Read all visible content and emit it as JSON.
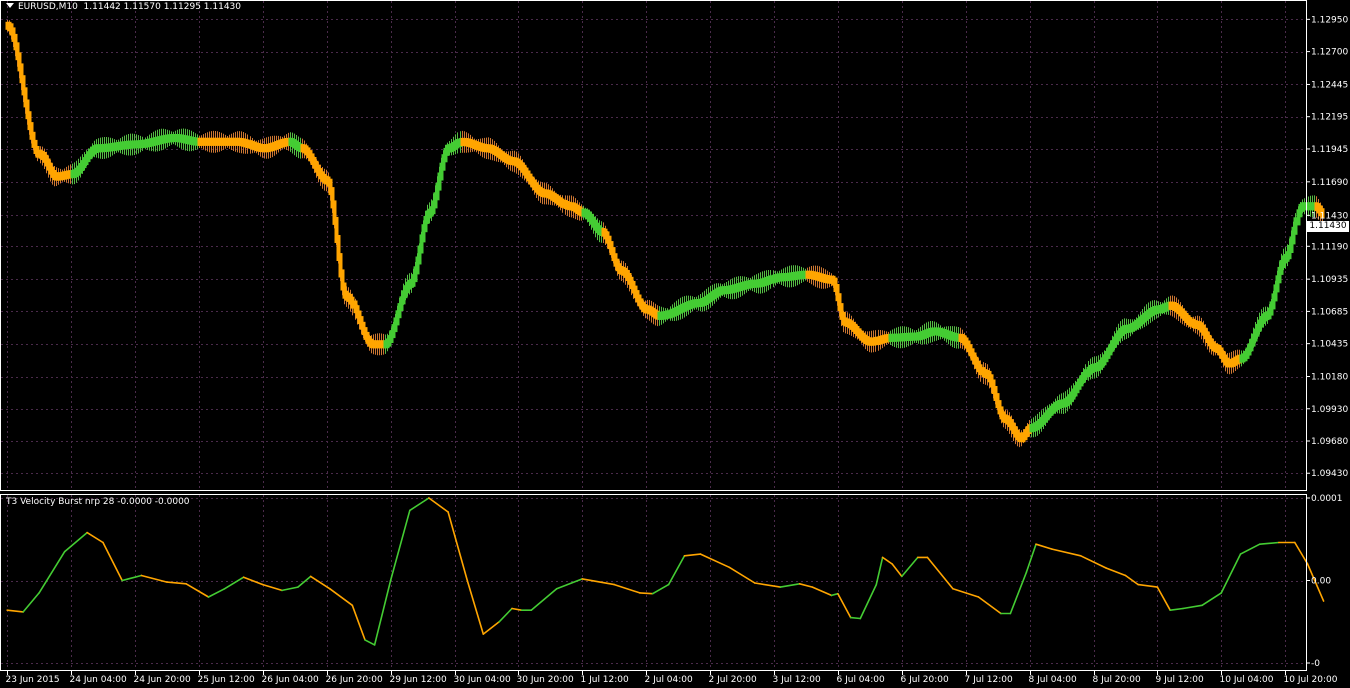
{
  "window": {
    "main_header": "EURUSD,M10  1.11442 1.11570 1.11295 1.11430",
    "indicator_header": "T3 Velocity Burst nrp 28 -0.0000 -0.0000",
    "current_price": "1.11430"
  },
  "colors": {
    "background": "#000000",
    "grid": "#4a2a4a",
    "frame": "#ffffff",
    "up": "#44cc33",
    "down": "#ffa500",
    "up_wick": "#55bb44",
    "down_wick": "#cc7733"
  },
  "chart_data": [
    {
      "type": "line",
      "name": "main-price",
      "ylim": [
        1.093,
        1.131
      ],
      "price_ticks": [
        "1.12950",
        "1.12700",
        "1.12445",
        "1.12195",
        "1.11945",
        "1.11690",
        "1.11430",
        "1.11190",
        "1.10935",
        "1.10685",
        "1.10435",
        "1.10180",
        "1.09930",
        "1.09680",
        "1.09430"
      ],
      "price_tick_values": [
        1.1295,
        1.127,
        1.12445,
        1.12195,
        1.11945,
        1.1169,
        1.1143,
        1.1119,
        1.10935,
        1.10685,
        1.10435,
        1.1018,
        1.0993,
        1.0968,
        1.0943
      ],
      "x_labels": [
        "23 Jun 2015",
        "24 Jun 04:00",
        "24 Jun 20:00",
        "25 Jun 12:00",
        "26 Jun 04:00",
        "26 Jun 20:00",
        "29 Jun 12:00",
        "30 Jun 04:00",
        "30 Jun 20:00",
        "1 Jul 12:00",
        "2 Jul 04:00",
        "2 Jul 20:00",
        "3 Jul 12:00",
        "6 Jul 04:00",
        "6 Jul 20:00",
        "7 Jul 12:00",
        "8 Jul 04:00",
        "8 Jul 20:00",
        "9 Jul 12:00",
        "10 Jul 04:00",
        "10 Jul 20:00"
      ],
      "x_label_positions": [
        0,
        1,
        2,
        3,
        4,
        5,
        6,
        7,
        8,
        9,
        10,
        11,
        12,
        13,
        14,
        15,
        16,
        17,
        18,
        19,
        20
      ],
      "xlim": [
        -0.05,
        20.2
      ],
      "keypoints": [
        [
          0.0,
          1.129,
          "down"
        ],
        [
          0.5,
          1.119,
          "down"
        ],
        [
          0.75,
          1.1173,
          "down"
        ],
        [
          1.0,
          1.1175,
          "up"
        ],
        [
          1.4,
          1.1195,
          "up"
        ],
        [
          2.0,
          1.1198,
          "up"
        ],
        [
          2.6,
          1.1203,
          "up"
        ],
        [
          3.0,
          1.12,
          "down"
        ],
        [
          3.6,
          1.12,
          "down"
        ],
        [
          4.0,
          1.1195,
          "down"
        ],
        [
          4.4,
          1.12,
          "up"
        ],
        [
          4.6,
          1.1195,
          "down"
        ],
        [
          5.0,
          1.117,
          "down"
        ],
        [
          5.3,
          1.108,
          "down"
        ],
        [
          5.7,
          1.1043,
          "down"
        ],
        [
          5.9,
          1.1043,
          "up"
        ],
        [
          6.3,
          1.109,
          "up"
        ],
        [
          6.6,
          1.1145,
          "up"
        ],
        [
          6.9,
          1.1195,
          "up"
        ],
        [
          7.1,
          1.12,
          "down"
        ],
        [
          7.5,
          1.1195,
          "down"
        ],
        [
          7.9,
          1.1185,
          "down"
        ],
        [
          8.4,
          1.116,
          "down"
        ],
        [
          8.8,
          1.115,
          "down"
        ],
        [
          9.0,
          1.1145,
          "up"
        ],
        [
          9.3,
          1.113,
          "down"
        ],
        [
          9.6,
          1.11,
          "down"
        ],
        [
          10.0,
          1.107,
          "down"
        ],
        [
          10.2,
          1.1065,
          "up"
        ],
        [
          10.8,
          1.1075,
          "up"
        ],
        [
          11.2,
          1.1085,
          "up"
        ],
        [
          11.7,
          1.109,
          "up"
        ],
        [
          12.1,
          1.1095,
          "up"
        ],
        [
          12.5,
          1.1097,
          "down"
        ],
        [
          12.9,
          1.1093,
          "down"
        ],
        [
          13.1,
          1.106,
          "down"
        ],
        [
          13.5,
          1.1045,
          "down"
        ],
        [
          13.8,
          1.1048,
          "up"
        ],
        [
          14.2,
          1.1049,
          "up"
        ],
        [
          14.5,
          1.1053,
          "up"
        ],
        [
          14.9,
          1.1048,
          "down"
        ],
        [
          15.3,
          1.102,
          "down"
        ],
        [
          15.6,
          1.0985,
          "down"
        ],
        [
          15.85,
          1.097,
          "down"
        ],
        [
          16.0,
          1.0978,
          "up"
        ],
        [
          16.5,
          1.0997,
          "up"
        ],
        [
          17.0,
          1.1025,
          "up"
        ],
        [
          17.5,
          1.1055,
          "up"
        ],
        [
          18.0,
          1.107,
          "up"
        ],
        [
          18.2,
          1.1073,
          "down"
        ],
        [
          18.6,
          1.1058,
          "down"
        ],
        [
          18.9,
          1.104,
          "down"
        ],
        [
          19.1,
          1.1028,
          "down"
        ],
        [
          19.3,
          1.1032,
          "up"
        ],
        [
          19.7,
          1.1065,
          "up"
        ],
        [
          20.0,
          1.111,
          "up"
        ],
        [
          20.25,
          1.115,
          "up"
        ],
        [
          20.45,
          1.115,
          "down"
        ],
        [
          20.6,
          1.1143,
          "down"
        ]
      ]
    },
    {
      "type": "line",
      "name": "T3 Velocity Burst nrp 28",
      "ylim": [
        -0.0001,
        0.0001
      ],
      "y_ticks": [
        "0.0001",
        "0.00",
        "-0"
      ],
      "y_tick_values": [
        0.0001,
        0.0,
        -0.0001
      ],
      "points": [
        [
          0.0,
          -3.6e-05,
          "down"
        ],
        [
          0.25,
          -3.8e-05,
          "down"
        ],
        [
          0.5,
          -1.5e-05,
          "up"
        ],
        [
          0.9,
          3.5e-05,
          "up"
        ],
        [
          1.25,
          5.8e-05,
          "up"
        ],
        [
          1.5,
          4.6e-05,
          "down"
        ],
        [
          1.8,
          0.0,
          "down"
        ],
        [
          2.1,
          6e-06,
          "up"
        ],
        [
          2.5,
          -2e-06,
          "down"
        ],
        [
          2.8,
          -4e-06,
          "down"
        ],
        [
          3.15,
          -2e-05,
          "down"
        ],
        [
          3.4,
          -1e-05,
          "up"
        ],
        [
          3.7,
          4e-06,
          "up"
        ],
        [
          4.0,
          -5e-06,
          "down"
        ],
        [
          4.3,
          -1.2e-05,
          "down"
        ],
        [
          4.55,
          -8e-06,
          "up"
        ],
        [
          4.75,
          5e-06,
          "up"
        ],
        [
          5.05,
          -1e-05,
          "down"
        ],
        [
          5.4,
          -3e-05,
          "down"
        ],
        [
          5.6,
          -7.2e-05,
          "down"
        ],
        [
          5.75,
          -7.8e-05,
          "up"
        ],
        [
          6.0,
          0.0,
          "up"
        ],
        [
          6.3,
          8.5e-05,
          "up"
        ],
        [
          6.6,
          0.0001,
          "up"
        ],
        [
          6.9,
          8.3e-05,
          "down"
        ],
        [
          7.2,
          0.0,
          "down"
        ],
        [
          7.45,
          -6.5e-05,
          "down"
        ],
        [
          7.7,
          -5e-05,
          "down"
        ],
        [
          7.9,
          -3.4e-05,
          "up"
        ],
        [
          8.05,
          -3.6e-05,
          "down"
        ],
        [
          8.2,
          -3.6e-05,
          "up"
        ],
        [
          8.6,
          -1e-05,
          "up"
        ],
        [
          9.0,
          2e-06,
          "up"
        ],
        [
          9.5,
          -5e-06,
          "down"
        ],
        [
          9.9,
          -1.5e-05,
          "down"
        ],
        [
          10.1,
          -1.6e-05,
          "down"
        ],
        [
          10.35,
          -5e-06,
          "up"
        ],
        [
          10.6,
          3e-05,
          "up"
        ],
        [
          10.85,
          3.2e-05,
          "down"
        ],
        [
          11.3,
          1.6e-05,
          "down"
        ],
        [
          11.7,
          -3e-06,
          "down"
        ],
        [
          12.1,
          -8e-06,
          "down"
        ],
        [
          12.4,
          -4e-06,
          "up"
        ],
        [
          12.6,
          -8e-06,
          "down"
        ],
        [
          12.9,
          -1.8e-05,
          "down"
        ],
        [
          13.0,
          -1.6e-05,
          "up"
        ],
        [
          13.2,
          -4.5e-05,
          "down"
        ],
        [
          13.35,
          -4.6e-05,
          "up"
        ],
        [
          13.6,
          -5e-06,
          "up"
        ],
        [
          13.7,
          2.8e-05,
          "up"
        ],
        [
          13.85,
          2e-05,
          "down"
        ],
        [
          14.0,
          5e-06,
          "down"
        ],
        [
          14.25,
          2.8e-05,
          "up"
        ],
        [
          14.4,
          2.8e-05,
          "down"
        ],
        [
          14.8,
          -1e-05,
          "down"
        ],
        [
          15.2,
          -2e-05,
          "down"
        ],
        [
          15.55,
          -4e-05,
          "down"
        ],
        [
          15.7,
          -4e-05,
          "up"
        ],
        [
          15.95,
          1e-05,
          "up"
        ],
        [
          16.1,
          4.4e-05,
          "up"
        ],
        [
          16.35,
          3.8e-05,
          "down"
        ],
        [
          16.8,
          3e-05,
          "down"
        ],
        [
          17.2,
          1.5e-05,
          "down"
        ],
        [
          17.5,
          6e-06,
          "down"
        ],
        [
          17.7,
          -5e-06,
          "down"
        ],
        [
          18.0,
          -8e-06,
          "down"
        ],
        [
          18.2,
          -3.6e-05,
          "down"
        ],
        [
          18.4,
          -3.4e-05,
          "up"
        ],
        [
          18.7,
          -3e-05,
          "up"
        ],
        [
          19.0,
          -1.5e-05,
          "up"
        ],
        [
          19.3,
          3.2e-05,
          "up"
        ],
        [
          19.6,
          4.4e-05,
          "up"
        ],
        [
          19.9,
          4.6e-05,
          "up"
        ],
        [
          20.15,
          4.6e-05,
          "down"
        ],
        [
          20.35,
          2e-05,
          "down"
        ],
        [
          20.6,
          -2.5e-05,
          "down"
        ]
      ]
    }
  ]
}
